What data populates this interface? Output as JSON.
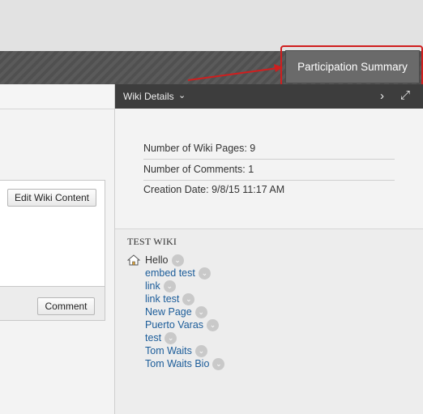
{
  "header": {
    "participation_summary_label": "Participation Summary"
  },
  "content": {
    "edit_wiki_label": "Edit Wiki Content",
    "comment_label": "Comment"
  },
  "wiki_details": {
    "title": "Wiki Details",
    "dropdown_glyph": "⌄",
    "next_glyph": "›",
    "expand_glyph": "⤢",
    "pages_text": "Number of Wiki Pages: 9",
    "comments_text": "Number of Comments: 1",
    "created_text": "Creation Date: 9/8/15 11:17 AM"
  },
  "tree": {
    "title": "TEST WIKI",
    "dd_glyph": "⌄",
    "home": "Hello",
    "pages": [
      "embed test",
      "link",
      "link test",
      "New Page",
      "Puerto Varas",
      "test",
      "Tom Waits",
      "Tom Waits Bio"
    ]
  },
  "colors": {
    "highlight": "#d01e1e",
    "link": "#1b5c99",
    "header_dark": "#3d3d3d"
  }
}
